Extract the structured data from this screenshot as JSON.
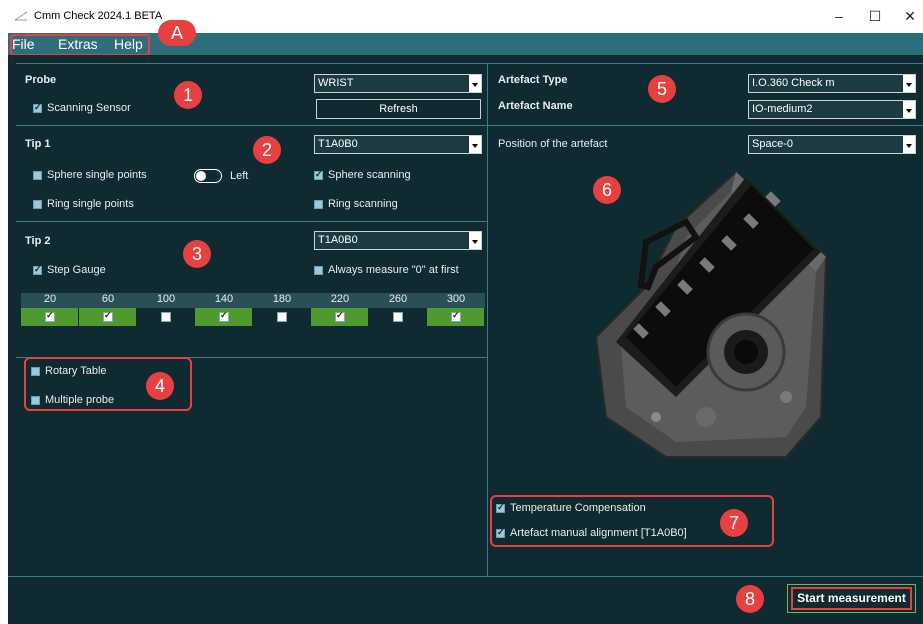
{
  "window": {
    "title": "Cmm Check 2024.1 BETA",
    "minimize": "–",
    "maximize": "☐",
    "close": "✕"
  },
  "menu": {
    "items": [
      "File",
      "Extras",
      "Help"
    ]
  },
  "badges": {
    "a": "A",
    "n1": "1",
    "n2": "2",
    "n3": "3",
    "n4": "4",
    "n5": "5",
    "n6": "6",
    "n7": "7",
    "n8": "8"
  },
  "probe": {
    "title": "Probe",
    "select_value": "WRIST",
    "scanning_sensor": {
      "label": "Scanning Sensor",
      "checked": true
    },
    "refresh_label": "Refresh"
  },
  "tip1": {
    "title": "Tip 1",
    "select_value": "T1A0B0",
    "sphere_single": {
      "label": "Sphere single points",
      "checked": false
    },
    "toggle_label": "Left",
    "sphere_scanning": {
      "label": "Sphere scanning",
      "checked": true
    },
    "ring_single": {
      "label": "Ring single points",
      "checked": false
    },
    "ring_scanning": {
      "label": "Ring scanning",
      "checked": false
    }
  },
  "tip2": {
    "title": "Tip 2",
    "select_value": "T1A0B0",
    "step_gauge": {
      "label": "Step Gauge",
      "checked": true
    },
    "always_zero": {
      "label": "Always measure \"0\" at first",
      "checked": false
    },
    "gauge": [
      {
        "value": "20",
        "checked": true
      },
      {
        "value": "60",
        "checked": true
      },
      {
        "value": "100",
        "checked": false
      },
      {
        "value": "140",
        "checked": true
      },
      {
        "value": "180",
        "checked": false
      },
      {
        "value": "220",
        "checked": true
      },
      {
        "value": "260",
        "checked": false
      },
      {
        "value": "300",
        "checked": true
      }
    ]
  },
  "options": {
    "rotary_table": {
      "label": "Rotary Table",
      "checked": false
    },
    "multiple_probe": {
      "label": "Multiple probe",
      "checked": false
    }
  },
  "artefact": {
    "type_label": "Artefact Type",
    "type_value": "I.O.360 Check m",
    "name_label": "Artefact Name",
    "name_value": "IO-medium2",
    "position_label": "Position of the artefact",
    "position_value": "Space-0"
  },
  "bottom_options": {
    "temp_comp": {
      "label": "Temperature Compensation",
      "checked": true
    },
    "manual_align": {
      "label": "Artefact manual alignment   [T1A0B0]",
      "checked": true
    }
  },
  "start_label": "Start measurement",
  "colors": {
    "background": "#0f2a31",
    "menubar": "#2e6e7a",
    "accent_red": "#e74040",
    "gauge_checked": "#4f9a2e",
    "gauge_unchecked": "#0f2a31"
  }
}
